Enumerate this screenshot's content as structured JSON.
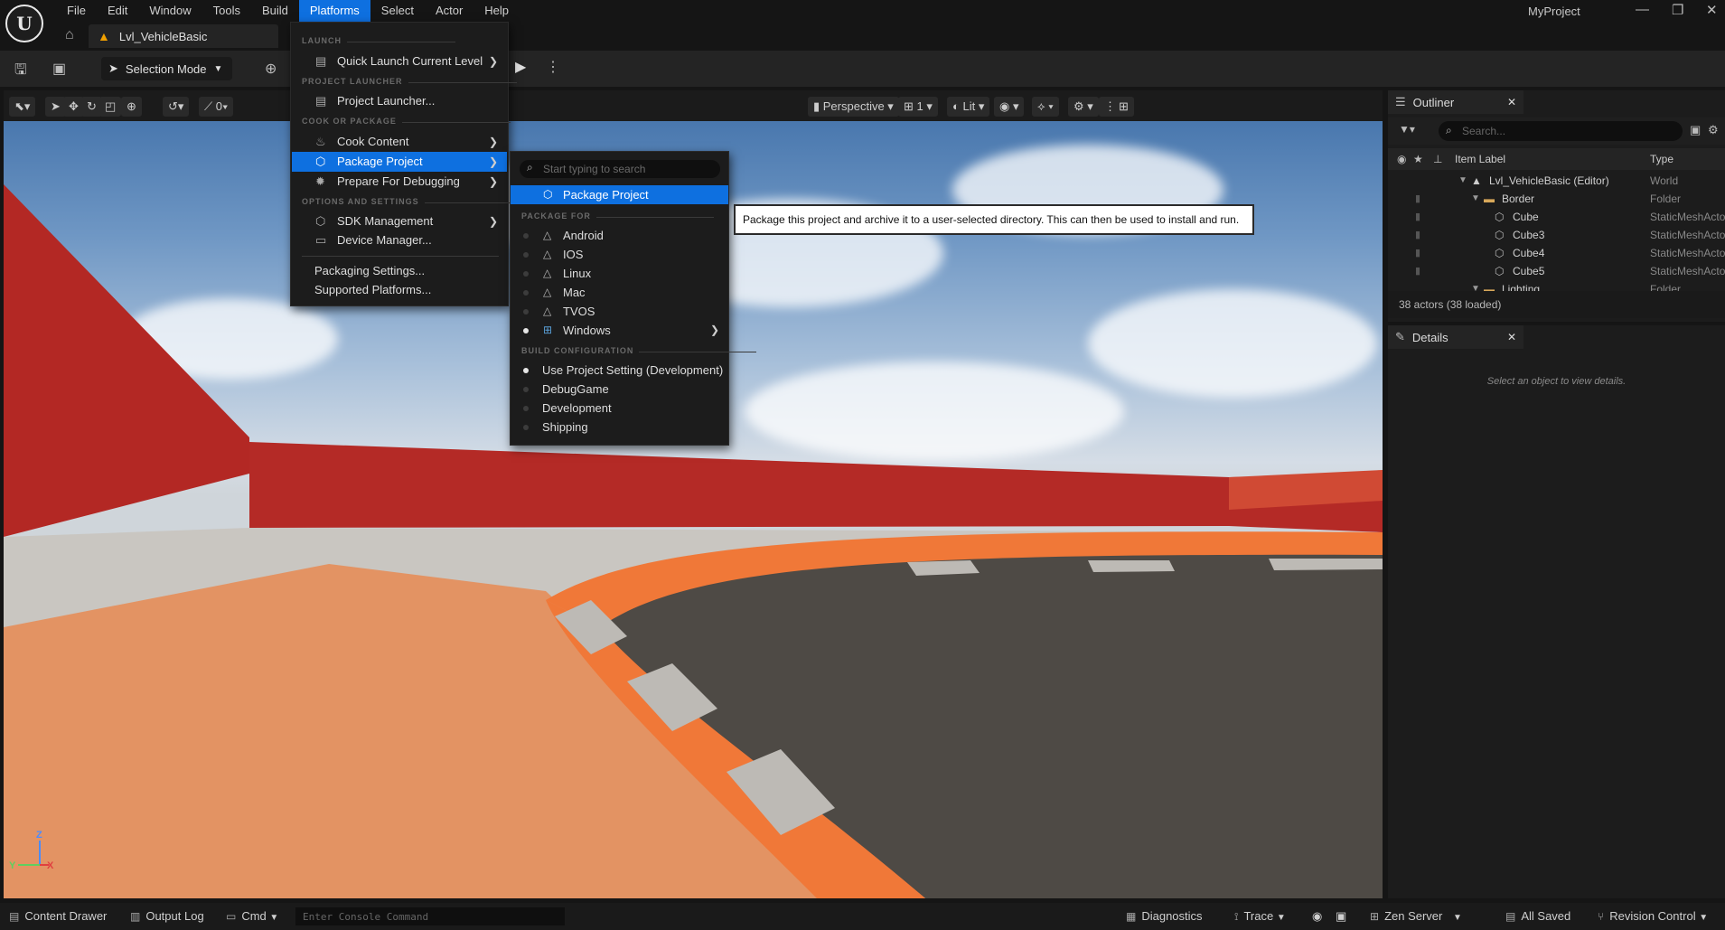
{
  "app": {
    "logo": "U",
    "project_name": "MyProject",
    "level_tab": "Lvl_VehicleBasic",
    "window_controls": [
      "—",
      "❐",
      "✕"
    ]
  },
  "menubar": {
    "items": [
      "File",
      "Edit",
      "Window",
      "Tools",
      "Build",
      "Platforms",
      "Select",
      "Actor",
      "Help"
    ],
    "active": "Platforms"
  },
  "toolbar": {
    "selection_mode": "Selection Mode"
  },
  "viewport": {
    "view_mode": "Perspective",
    "camera_speed": "1",
    "lighting": "Lit",
    "snap_value": "0",
    "axis_labels": {
      "z": "Z",
      "y": "Y",
      "x": "X"
    }
  },
  "platforms_menu": {
    "sections": {
      "launch": "LAUNCH",
      "project_launcher": "PROJECT LAUNCHER",
      "cook_or_package": "COOK OR PACKAGE",
      "options_and_settings": "OPTIONS AND SETTINGS"
    },
    "items": {
      "quick_launch": "Quick Launch Current Level",
      "project_launcher": "Project Launcher...",
      "cook_content": "Cook Content",
      "package_project": "Package Project",
      "prepare_debugging": "Prepare For Debugging",
      "sdk_management": "SDK Management",
      "device_manager": "Device Manager...",
      "packaging_settings": "Packaging Settings...",
      "supported_platforms": "Supported Platforms..."
    }
  },
  "package_menu": {
    "search_placeholder": "Start typing to search",
    "header_item": "Package Project",
    "section_package_for": "PACKAGE FOR",
    "platforms": [
      "Android",
      "IOS",
      "Linux",
      "Mac",
      "TVOS",
      "Windows"
    ],
    "section_build_config": "BUILD CONFIGURATION",
    "build_configs": [
      "Use Project Setting (Development)",
      "DebugGame",
      "Development",
      "Shipping"
    ]
  },
  "tooltip": {
    "text": "Package this project and archive it to a user-selected directory. This can then be used to install and run."
  },
  "outliner": {
    "tab_label": "Outliner",
    "search_placeholder": "Search...",
    "col_item_label": "Item Label",
    "col_type": "Type",
    "rows": [
      {
        "label": "Lvl_VehicleBasic (Editor)",
        "type": "World"
      },
      {
        "label": "Border",
        "type": "Folder"
      },
      {
        "label": "Cube",
        "type": "StaticMeshActor"
      },
      {
        "label": "Cube3",
        "type": "StaticMeshActor"
      },
      {
        "label": "Cube4",
        "type": "StaticMeshActor"
      },
      {
        "label": "Cube5",
        "type": "StaticMeshActor"
      },
      {
        "label": "Lighting",
        "type": "Folder"
      }
    ],
    "actor_count": "38 actors (38 loaded)"
  },
  "details": {
    "tab_label": "Details",
    "empty_message": "Select an object to view details."
  },
  "statusbar": {
    "content_drawer": "Content Drawer",
    "output_log": "Output Log",
    "cmd": "Cmd",
    "console_placeholder": "Enter Console Command",
    "diagnostics": "Diagnostics",
    "trace": "Trace",
    "zen_server": "Zen Server",
    "all_saved": "All Saved",
    "revision_control": "Revision Control"
  },
  "colors": {
    "accent": "#0e70e0",
    "wall_red": "#c0302c",
    "curb_orange": "#f07838",
    "track_dark": "#4a4642"
  }
}
